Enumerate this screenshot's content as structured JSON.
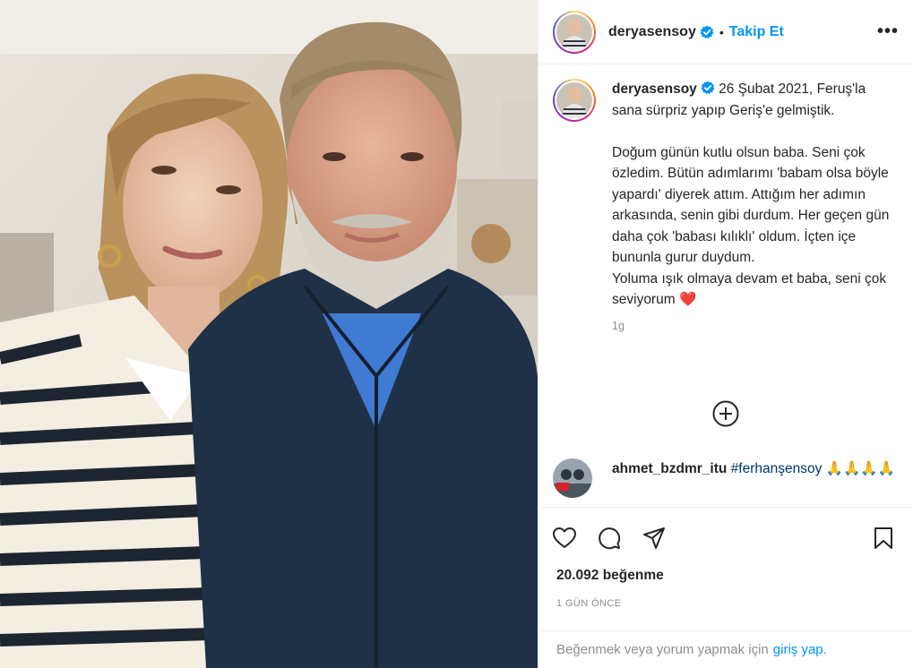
{
  "post": {
    "username": "deryasensoy",
    "follow_label": "Takip Et",
    "more_icon": "more-options-icon",
    "verified_color": "#0095f6"
  },
  "caption": {
    "username": "deryasensoy",
    "date_text": "26 Şubat 2021,",
    "text": "Feruş'la sana sürpriz yapıp Geriş'e gelmiştik.\n\nDoğum günün kutlu olsun baba. Seni çok özledim. Bütün adımlarımı 'babam olsa böyle yapardı' diyerek attım. Attığım her adımın arkasında, senin gibi durdum. Her geçen gün daha çok 'babası kılıklı' oldum. İçten içe bununla gurur duydum.\nYoluma ışık olmaya devam et baba, seni çok seviyorum ",
    "heart": "❤️",
    "age": "1g"
  },
  "comment": {
    "username": "ahmet_bzdmr_itu",
    "hashtag": "#ferhanşensoy",
    "emoji": "🙏🙏🙏🙏"
  },
  "stats": {
    "likes": "20.092 beğenme",
    "date": "1 GÜN ÖNCE"
  },
  "footer": {
    "text": "Beğenmek veya yorum yapmak için",
    "link": "giriş yap",
    "suffix": "."
  },
  "colors": {
    "link": "#0095f6",
    "text": "#262626",
    "muted": "#8e8e8e",
    "border": "#efefef"
  }
}
